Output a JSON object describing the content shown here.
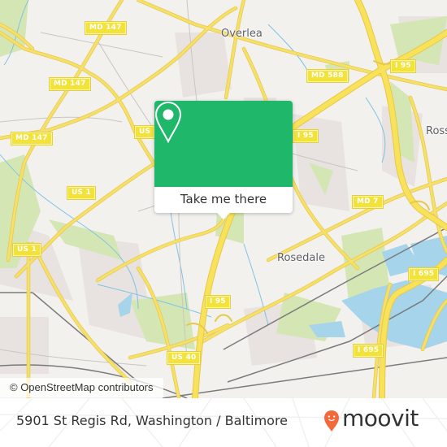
{
  "map": {
    "place_labels": [
      {
        "name": "Overlea"
      },
      {
        "name": "Rosedale"
      },
      {
        "name": "Ross"
      }
    ],
    "road_shields": [
      {
        "label": "MD 147"
      },
      {
        "label": "MD 147"
      },
      {
        "label": "MD 147"
      },
      {
        "label": "US"
      },
      {
        "label": "US 1"
      },
      {
        "label": "US 1"
      },
      {
        "label": "MD 588"
      },
      {
        "label": "I 95"
      },
      {
        "label": "I 95"
      },
      {
        "label": "I 95"
      },
      {
        "label": "MD 7"
      },
      {
        "label": "I 695"
      },
      {
        "label": "I 695"
      },
      {
        "label": "US 40"
      }
    ],
    "attribution": "© OpenStreetMap contributors",
    "colors": {
      "land": "#f2f1ee",
      "road": "#f5e06a",
      "water": "#a6d4ea",
      "park": "#d7e8b8"
    }
  },
  "popup": {
    "icon": "location-pin-icon",
    "button_label": "Take me there",
    "accent_color": "#1fb86a"
  },
  "footer": {
    "address": "5901 St Regis Rd, Washington / Baltimore",
    "brand": "moovit",
    "brand_icon": "moovit-logo-pin-icon",
    "brand_color": "#f26a3b"
  }
}
